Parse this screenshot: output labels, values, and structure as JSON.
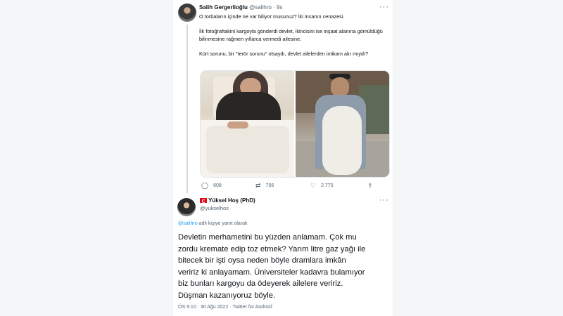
{
  "tweet1": {
    "name": "Salih Gergerlioğlu",
    "handle": "@salihro",
    "sep": "·",
    "time": "9s",
    "more": "···",
    "paragraphs": [
      "O torbaların içinde ne var biliyor musunuz? İki insanın cenazesi.",
      "İlk fotoğraftakini kargoyla gönderdi devlet, ikincisini ise inşaat alanına gömüldüğü bilinmesine rağmen yıllarca vermedi ailesine.",
      "Kürt sorunu, bir \"terör sorunu\" olsaydı, devlet ailelerden intikam alır mıydı?"
    ],
    "stats": {
      "replies": "608",
      "retweets": "756",
      "likes": "2.775"
    }
  },
  "tweet2": {
    "name": "Yüksel Hoş (PhD)",
    "handle": "@yukselhos",
    "more": "···",
    "reply_handle": "@salihro",
    "reply_text": " adlı kişiye yanıt olarak",
    "lines": [
      "Devletin merhametini bu yüzden anlamam. Çok mu",
      "zordu kremate edip toz etmek? Yarım litre gaz yağı ile",
      "bitecek bir işti oysa neden böyle dramlara imkân",
      "veririz ki anlayamam. Üniversiteler kadavra bulamıyor",
      "biz bunları kargoyu da ödeyerek ailelere veririz.",
      "Düşman kazanıyoruz böyle."
    ],
    "meta": "ÖS 9:10 · 30 Ağu 2022 · Twitter for Android"
  }
}
